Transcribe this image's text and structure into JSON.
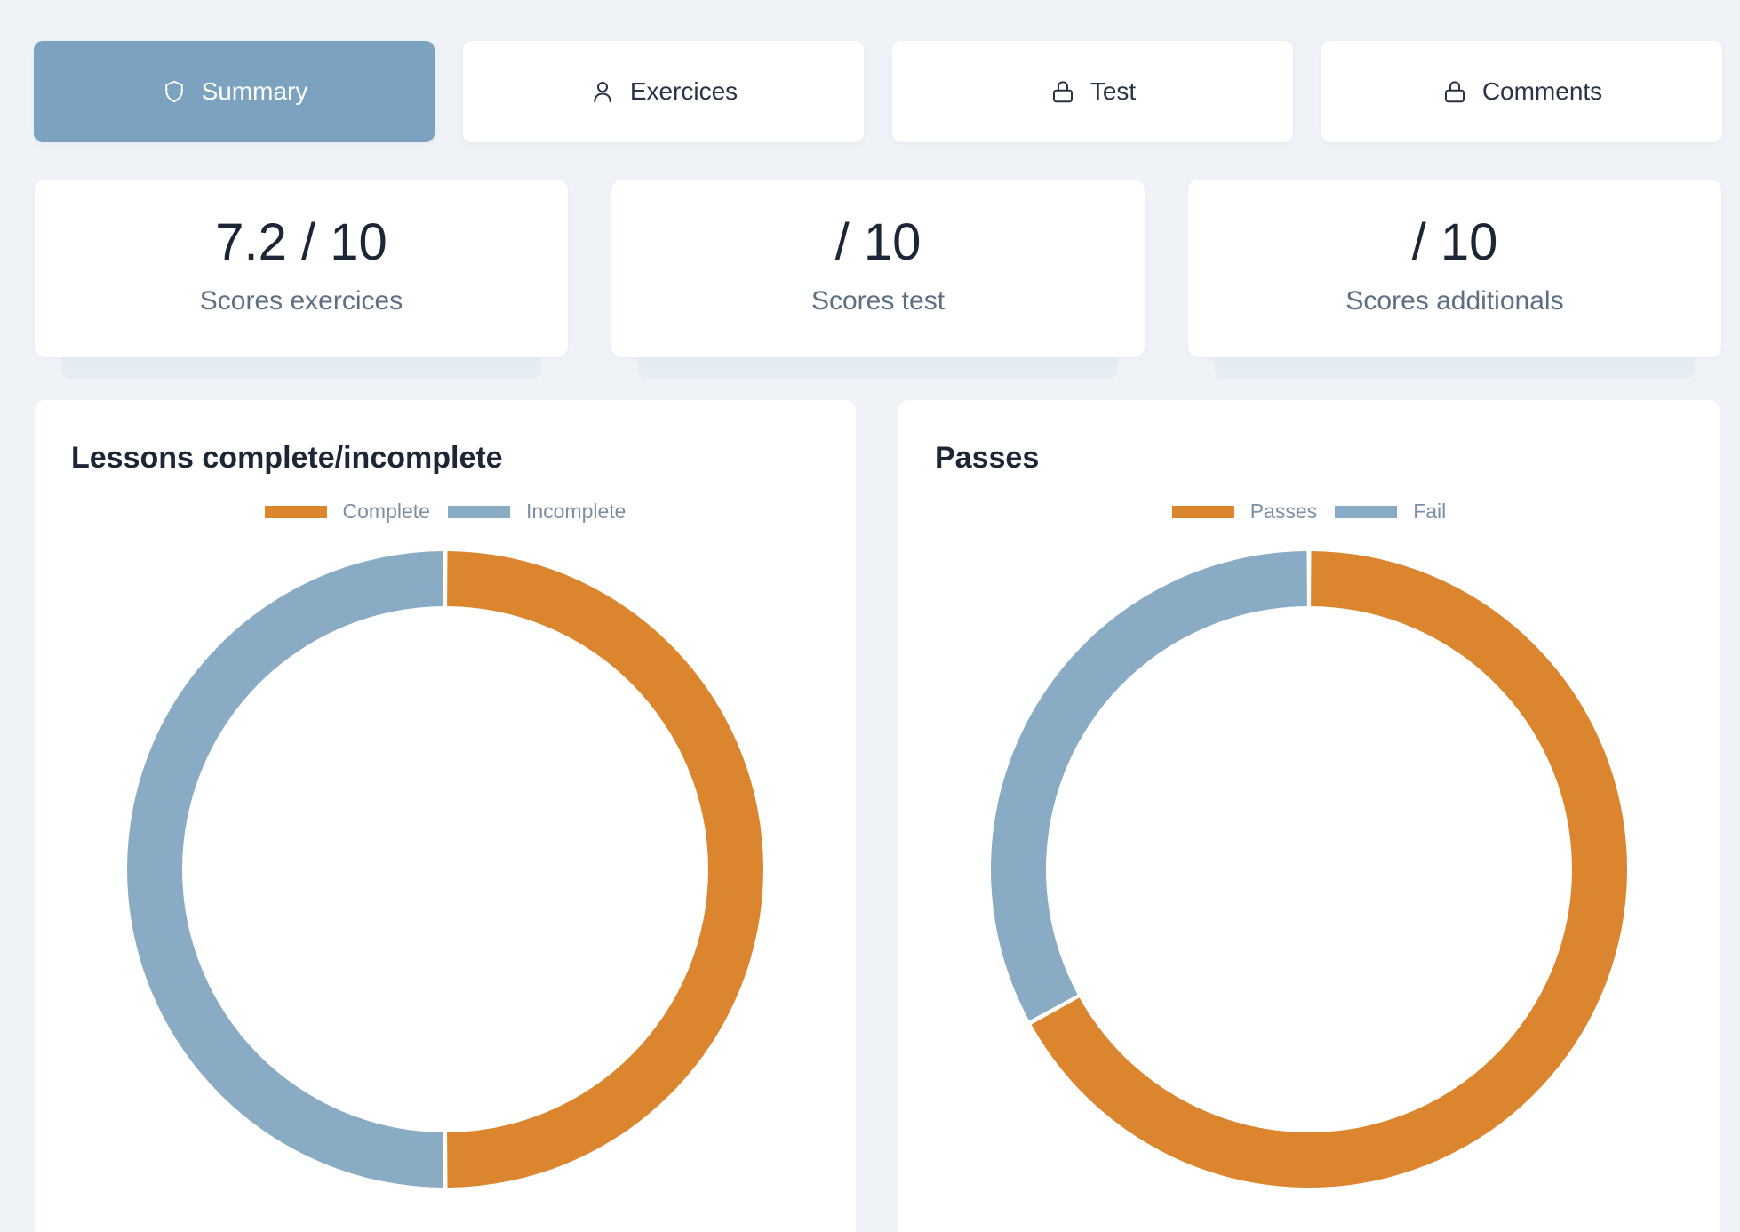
{
  "tabs": [
    {
      "label": "Summary",
      "icon": "shield-icon",
      "active": true
    },
    {
      "label": "Exercices",
      "icon": "user-icon",
      "active": false
    },
    {
      "label": "Test",
      "icon": "lock-icon",
      "active": false
    },
    {
      "label": "Comments",
      "icon": "lock-icon",
      "active": false
    }
  ],
  "scores": [
    {
      "value": "7.2 / 10",
      "label": "Scores exercices"
    },
    {
      "value": "/ 10",
      "label": "Scores test"
    },
    {
      "value": "/ 10",
      "label": "Scores additionals"
    }
  ],
  "colors": {
    "accent": "#7ba3bf",
    "orange": "#dc852f",
    "blue": "#89abc3"
  },
  "chart_data": [
    {
      "type": "pie",
      "title": "Lessons complete/incomplete",
      "legend_position": "top",
      "categories": [
        "Complete",
        "Incomplete"
      ],
      "values": [
        50,
        50
      ],
      "colors": [
        "#dc852f",
        "#89abc3"
      ]
    },
    {
      "type": "pie",
      "title": "Passes",
      "legend_position": "top",
      "categories": [
        "Passes",
        "Fail"
      ],
      "values": [
        67,
        33
      ],
      "colors": [
        "#dc852f",
        "#89abc3"
      ]
    }
  ]
}
